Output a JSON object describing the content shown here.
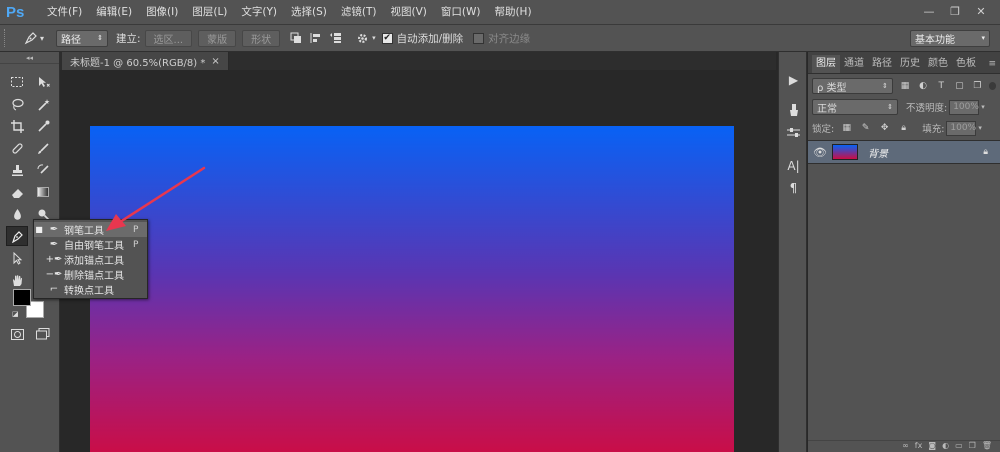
{
  "app": {
    "logo": "Ps"
  },
  "menu": [
    "文件(F)",
    "编辑(E)",
    "图像(I)",
    "图层(L)",
    "文字(Y)",
    "选择(S)",
    "滤镜(T)",
    "视图(V)",
    "窗口(W)",
    "帮助(H)"
  ],
  "window_controls": {
    "minimize": "—",
    "restore": "❐",
    "close": "✕"
  },
  "options": {
    "mode_value": "路径",
    "make_label": "建立:",
    "selection_btn": "选区...",
    "mask_btn": "蒙版",
    "shape_btn": "形状",
    "auto_add_delete": "自动添加/删除",
    "auto_add_checked": true,
    "align_edges": "对齐边缘",
    "workspace": "基本功能"
  },
  "document": {
    "tab_title": "未标题-1 @ 60.5%(RGB/8) *",
    "close": "×"
  },
  "flyout": {
    "items": [
      {
        "label": "钢笔工具",
        "shortcut": "P",
        "selected": true,
        "icon": "pen-icon"
      },
      {
        "label": "自由钢笔工具",
        "shortcut": "P",
        "selected": false,
        "icon": "freeform-pen-icon"
      },
      {
        "label": "添加锚点工具",
        "shortcut": "",
        "selected": false,
        "icon": "add-anchor-icon"
      },
      {
        "label": "删除锚点工具",
        "shortcut": "",
        "selected": false,
        "icon": "delete-anchor-icon"
      },
      {
        "label": "转换点工具",
        "shortcut": "",
        "selected": false,
        "icon": "convert-point-icon"
      }
    ]
  },
  "panels": {
    "tabs": [
      "图层",
      "通道",
      "路径",
      "历史",
      "颜色",
      "色板"
    ],
    "active_tab": "图层",
    "filter_label": "ρ 类型",
    "blend_mode": "正常",
    "opacity_label": "不透明度:",
    "opacity_value": "100%",
    "lock_label": "锁定:",
    "fill_label": "填充:",
    "fill_value": "100%",
    "layer_name": "背景"
  },
  "colors": {
    "gradient_top": "#0862f5",
    "gradient_bottom": "#cb0d45",
    "arrow": "#e8374f",
    "ps_blue": "#4fa8f5"
  }
}
